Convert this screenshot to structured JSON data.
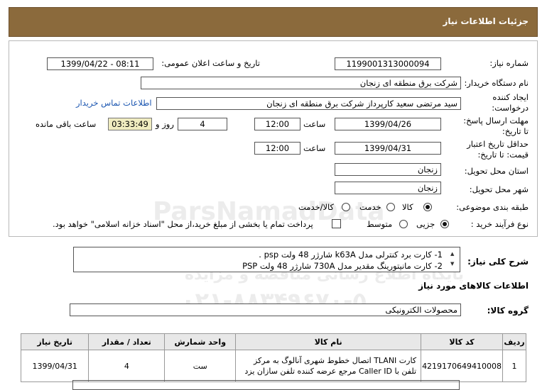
{
  "header": {
    "title": "جزئیات اطلاعات نیاز"
  },
  "form": {
    "need_number_label": "شماره نیاز:",
    "need_number": "1199001313000094",
    "announce_label": "تاریخ و ساعت اعلان عمومی:",
    "announce_value": "1399/04/22 - 08:11",
    "buyer_label": "نام دستگاه خریدار:",
    "buyer_value": "شرکت برق منطقه ای زنجان",
    "creator_label_1": "ایجاد کننده",
    "creator_label_2": "درخواست:",
    "creator_value": "سید مرتضی  سعید کارپرداز شرکت برق منطقه ای زنجان",
    "contact_link": "اطلاعات تماس خریدار",
    "deadline_label_1": "مهلت ارسال پاسخ:",
    "deadline_label_2": "تا تاریخ:",
    "deadline_date": "1399/04/26",
    "time_label": "ساعت",
    "deadline_time": "12:00",
    "days_value": "4",
    "days_label": "روز و",
    "timer_value": "03:33:49",
    "remaining_label": "ساعت باقی مانده",
    "validity_label_1": "حداقل تاریخ اعتبار",
    "validity_label_2": "قیمت: تا تاریخ:",
    "validity_date": "1399/04/31",
    "validity_time": "12:00",
    "province_label": "استان محل تحویل:",
    "province_value": "زنجان",
    "city_label": "شهر محل تحویل:",
    "city_value": "زنجان",
    "category_label": "طبقه بندی موضوعی:",
    "category_options": [
      "کالا",
      "خدمت",
      "کالا/خدمت"
    ],
    "category_selected": "کالا",
    "process_label": "نوع فرآیند خرید :",
    "process_options": [
      "جزیی",
      "متوسط"
    ],
    "process_selected": "جزیی",
    "payment_note": "پرداخت تمام یا بخشی از مبلغ خرید،از محل \"اسناد خزانه اسلامی\" خواهد بود."
  },
  "description": {
    "label": "شرح کلی نیاز:",
    "lines": [
      "1- کارت برد کنترلی مدل k63A شارژر 48 ولت psp  .",
      "2- کارت مانیتورینگ مقدیر مدل 730A شارژر 48 ولت PSP"
    ]
  },
  "goods": {
    "section_title": "اطلاعات کالاهای مورد نیاز",
    "group_label": "گروه کالا:",
    "group_value": "محصولات الکترونیکی",
    "columns": [
      "ردیف",
      "کد کالا",
      "نام کالا",
      "واحد شمارش",
      "تعداد / مقدار",
      "تاریخ نیاز"
    ],
    "rows": [
      {
        "row": "1",
        "code": "4219170649410008",
        "name": "کارت TLANI اتصال خطوط شهری آنالوگ به مرکز تلفن با Caller ID مرجع عرضه کننده تلفن سازان یزد",
        "unit": "ست",
        "qty": "4",
        "date": "1399/04/31"
      }
    ]
  },
  "watermark": {
    "line1": "ParsNamadData",
    "line2": "پایگاه اطلاع رسانی مناقصه و مزایده",
    "phone": "۰۲۱-۸۸۳۴۹۶۷۰-۵"
  },
  "colors": {
    "header_bg": "#8b6a3c",
    "timer_bg": "#f0ecc0",
    "link": "#1a55b0"
  }
}
